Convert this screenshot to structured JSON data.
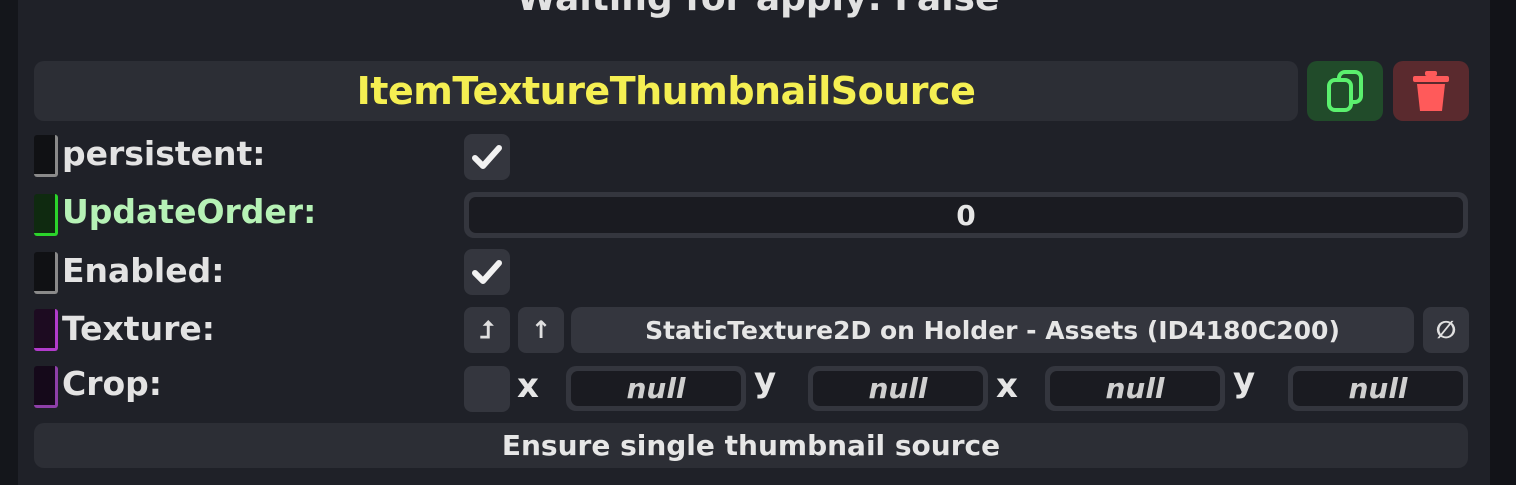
{
  "status": {
    "text": "Waiting for apply: False"
  },
  "component": {
    "title": "ItemTextureThumbnailSource",
    "title_color": "#f5ef52",
    "duplicate_icon": "copy-icon",
    "delete_icon": "trash-icon"
  },
  "fields": {
    "persistent": {
      "label": "persistent:",
      "checked": true,
      "marker_color": "#8a8a8a"
    },
    "update_order": {
      "label": "UpdateOrder:",
      "value": "0",
      "label_color": "#b6f2b6",
      "marker_color": "#2bd42b"
    },
    "enabled": {
      "label": "Enabled:",
      "checked": true,
      "marker_color": "#8a8a8a"
    },
    "texture": {
      "label": "Texture:",
      "value": "StaticTexture2D on Holder - Assets (ID4180C200)",
      "jump_icon": "jump-to-icon",
      "parent_icon": "arrow-up-icon",
      "clear_icon": "null-icon",
      "jump_glyph": "⮥",
      "parent_glyph": "↑",
      "clear_glyph": "∅",
      "marker_color": "#b23bcc"
    },
    "crop": {
      "label": "Crop:",
      "has_value": false,
      "axis_x1": "x",
      "axis_y1": "y",
      "axis_x2": "x",
      "axis_y2": "y",
      "x1": "null",
      "y1": "null",
      "x2": "null",
      "y2": "null",
      "marker_color": "#8e3fa8"
    }
  },
  "actions": {
    "ensure_single": "Ensure single thumbnail source"
  }
}
